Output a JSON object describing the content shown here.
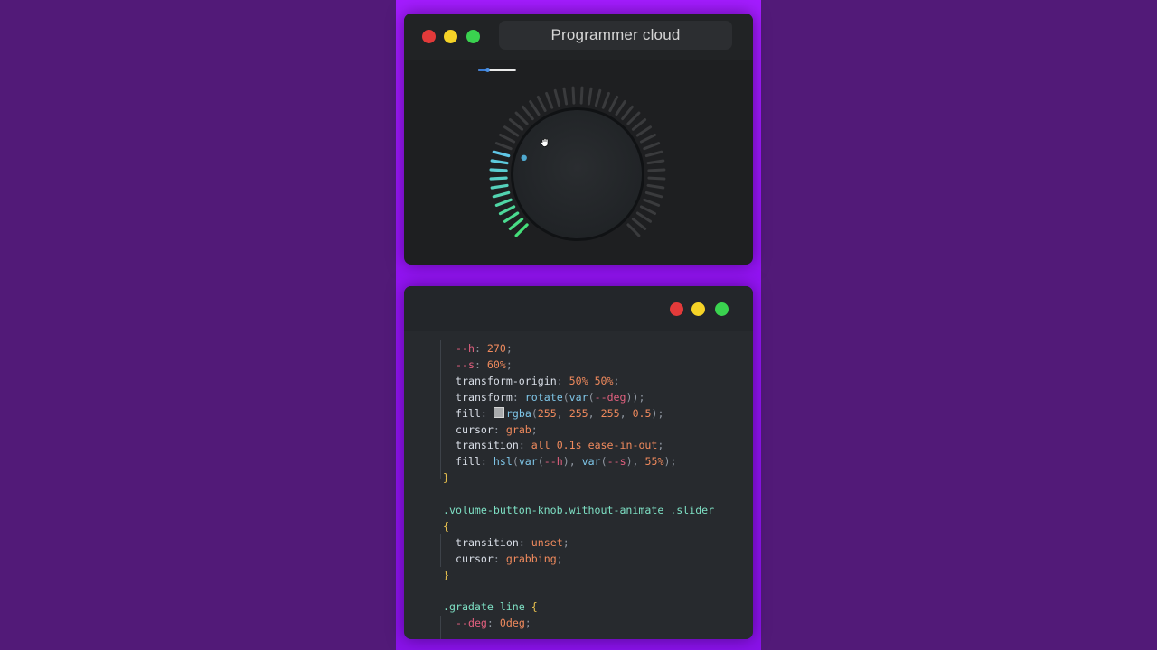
{
  "app": {
    "title": "Programmer cloud"
  },
  "colors": {
    "accent_gradient_start": "#5fc6e6",
    "accent_gradient_end": "#45e07a",
    "knob_indicator": "#4fa9cf",
    "background_stage": "#9a16f8"
  },
  "icons": {
    "cursor": "grab-hand-icon"
  },
  "preview": {
    "volume_level": 0.23
  },
  "code": {
    "lines": [
      {
        "parts": [
          {
            "t": "--h",
            "c": "var"
          },
          {
            "t": ": ",
            "c": "punc"
          },
          {
            "t": "270",
            "c": "num"
          },
          {
            "t": ";",
            "c": "punc"
          }
        ]
      },
      {
        "parts": [
          {
            "t": "--s",
            "c": "var"
          },
          {
            "t": ": ",
            "c": "punc"
          },
          {
            "t": "60%",
            "c": "num"
          },
          {
            "t": ";",
            "c": "punc"
          }
        ]
      },
      {
        "parts": [
          {
            "t": "transform-origin",
            "c": "prop"
          },
          {
            "t": ": ",
            "c": "punc"
          },
          {
            "t": "50% 50%",
            "c": "num"
          },
          {
            "t": ";",
            "c": "punc"
          }
        ]
      },
      {
        "parts": [
          {
            "t": "transform",
            "c": "prop"
          },
          {
            "t": ": ",
            "c": "punc"
          },
          {
            "t": "rotate",
            "c": "fn"
          },
          {
            "t": "(",
            "c": "punc"
          },
          {
            "t": "var",
            "c": "fn"
          },
          {
            "t": "(",
            "c": "punc"
          },
          {
            "t": "--deg",
            "c": "var"
          },
          {
            "t": "));",
            "c": "punc"
          }
        ]
      },
      {
        "parts": [
          {
            "t": "fill",
            "c": "prop"
          },
          {
            "t": ": ",
            "c": "punc"
          },
          {
            "t": "",
            "c": "swatch"
          },
          {
            "t": "rgba",
            "c": "fn"
          },
          {
            "t": "(",
            "c": "punc"
          },
          {
            "t": "255",
            "c": "num"
          },
          {
            "t": ", ",
            "c": "punc"
          },
          {
            "t": "255",
            "c": "num"
          },
          {
            "t": ", ",
            "c": "punc"
          },
          {
            "t": "255",
            "c": "num"
          },
          {
            "t": ", ",
            "c": "punc"
          },
          {
            "t": "0.5",
            "c": "num"
          },
          {
            "t": ");",
            "c": "punc"
          }
        ]
      },
      {
        "parts": [
          {
            "t": "cursor",
            "c": "prop"
          },
          {
            "t": ": ",
            "c": "punc"
          },
          {
            "t": "grab",
            "c": "val"
          },
          {
            "t": ";",
            "c": "punc"
          }
        ]
      },
      {
        "parts": [
          {
            "t": "transition",
            "c": "prop"
          },
          {
            "t": ": ",
            "c": "punc"
          },
          {
            "t": "all 0.1s ease-in-out",
            "c": "val"
          },
          {
            "t": ";",
            "c": "punc"
          }
        ]
      },
      {
        "parts": [
          {
            "t": "fill",
            "c": "prop"
          },
          {
            "t": ": ",
            "c": "punc"
          },
          {
            "t": "hsl",
            "c": "fn"
          },
          {
            "t": "(",
            "c": "punc"
          },
          {
            "t": "var",
            "c": "fn"
          },
          {
            "t": "(",
            "c": "punc"
          },
          {
            "t": "--h",
            "c": "var"
          },
          {
            "t": "), ",
            "c": "punc"
          },
          {
            "t": "var",
            "c": "fn"
          },
          {
            "t": "(",
            "c": "punc"
          },
          {
            "t": "--s",
            "c": "var"
          },
          {
            "t": "), ",
            "c": "punc"
          },
          {
            "t": "55%",
            "c": "num"
          },
          {
            "t": ");",
            "c": "punc"
          }
        ]
      },
      {
        "parts": [
          {
            "t": "}",
            "c": "brace"
          }
        ]
      },
      {
        "parts": []
      },
      {
        "parts": [
          {
            "t": ".volume-button-knob.without-animate .slider",
            "c": "sel"
          }
        ]
      },
      {
        "parts": [
          {
            "t": "{",
            "c": "brace"
          }
        ]
      },
      {
        "parts": [
          {
            "t": "transition",
            "c": "prop"
          },
          {
            "t": ": ",
            "c": "punc"
          },
          {
            "t": "unset",
            "c": "val"
          },
          {
            "t": ";",
            "c": "punc"
          }
        ]
      },
      {
        "parts": [
          {
            "t": "cursor",
            "c": "prop"
          },
          {
            "t": ": ",
            "c": "punc"
          },
          {
            "t": "grabbing",
            "c": "val"
          },
          {
            "t": ";",
            "c": "punc"
          }
        ]
      },
      {
        "parts": [
          {
            "t": "}",
            "c": "brace"
          }
        ]
      },
      {
        "parts": []
      },
      {
        "parts": [
          {
            "t": ".gradate line ",
            "c": "sel"
          },
          {
            "t": "{",
            "c": "brace"
          }
        ]
      },
      {
        "parts": [
          {
            "t": "--deg",
            "c": "var"
          },
          {
            "t": ": ",
            "c": "punc"
          },
          {
            "t": "0deg",
            "c": "num"
          },
          {
            "t": ";",
            "c": "punc"
          }
        ]
      }
    ]
  }
}
